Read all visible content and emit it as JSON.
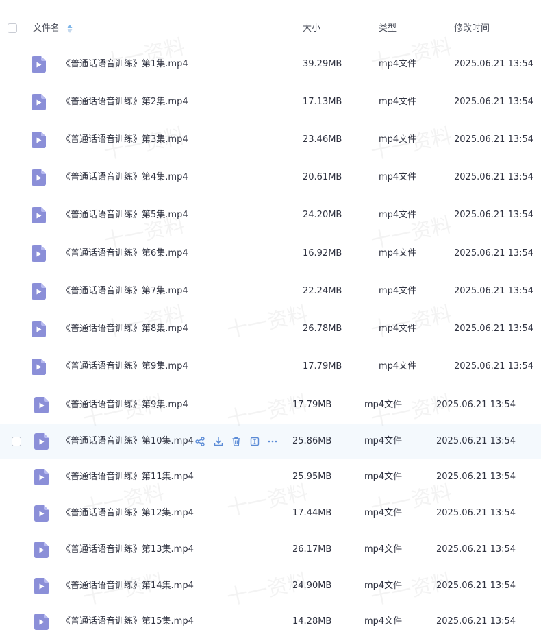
{
  "header": {
    "name_label": "文件名",
    "size_label": "大小",
    "type_label": "类型",
    "modified_label": "修改时间"
  },
  "watermark": "十一资料",
  "colors": {
    "file_icon": "#8b8fd8",
    "action_icon": "#5b8bd6",
    "row_hover": "#f4f9fd"
  },
  "rows": [
    {
      "name": "《普通话语音训练》第1集.mp4",
      "size": "39.29MB",
      "type": "mp4文件",
      "modified": "2025.06.21 13:54"
    },
    {
      "name": "《普通话语音训练》第2集.mp4",
      "size": "17.13MB",
      "type": "mp4文件",
      "modified": "2025.06.21 13:54"
    },
    {
      "name": "《普通话语音训练》第3集.mp4",
      "size": "23.46MB",
      "type": "mp4文件",
      "modified": "2025.06.21 13:54"
    },
    {
      "name": "《普通话语音训练》第4集.mp4",
      "size": "20.61MB",
      "type": "mp4文件",
      "modified": "2025.06.21 13:54"
    },
    {
      "name": "《普通话语音训练》第5集.mp4",
      "size": "24.20MB",
      "type": "mp4文件",
      "modified": "2025.06.21 13:54"
    },
    {
      "name": "《普通话语音训练》第6集.mp4",
      "size": "16.92MB",
      "type": "mp4文件",
      "modified": "2025.06.21 13:54"
    },
    {
      "name": "《普通话语音训练》第7集.mp4",
      "size": "22.24MB",
      "type": "mp4文件",
      "modified": "2025.06.21 13:54"
    },
    {
      "name": "《普通话语音训练》第8集.mp4",
      "size": "26.78MB",
      "type": "mp4文件",
      "modified": "2025.06.21 13:54"
    },
    {
      "name": "《普通话语音训练》第9集.mp4",
      "size": "17.79MB",
      "type": "mp4文件",
      "modified": "2025.06.21 13:54"
    },
    {
      "name": "《普通话语音训练》第9集.mp4",
      "size": "17.79MB",
      "type": "mp4文件",
      "modified": "2025.06.21 13:54"
    },
    {
      "name": "《普通话语音训练》第10集.mp4",
      "size": "25.86MB",
      "type": "mp4文件",
      "modified": "2025.06.21 13:54",
      "hovered": true
    },
    {
      "name": "《普通话语音训练》第11集.mp4",
      "size": "25.95MB",
      "type": "mp4文件",
      "modified": "2025.06.21 13:54"
    },
    {
      "name": "《普通话语音训练》第12集.mp4",
      "size": "17.44MB",
      "type": "mp4文件",
      "modified": "2025.06.21 13:54"
    },
    {
      "name": "《普通话语音训练》第13集.mp4",
      "size": "26.17MB",
      "type": "mp4文件",
      "modified": "2025.06.21 13:54"
    },
    {
      "name": "《普通话语音训练》第14集.mp4",
      "size": "24.90MB",
      "type": "mp4文件",
      "modified": "2025.06.21 13:54"
    },
    {
      "name": "《普通话语音训练》第15集.mp4",
      "size": "14.28MB",
      "type": "mp4文件",
      "modified": "2025.06.21 13:54"
    }
  ],
  "row_actions": [
    {
      "name": "share-icon"
    },
    {
      "name": "download-icon"
    },
    {
      "name": "delete-icon"
    },
    {
      "name": "rename-icon"
    },
    {
      "name": "more-icon"
    }
  ]
}
